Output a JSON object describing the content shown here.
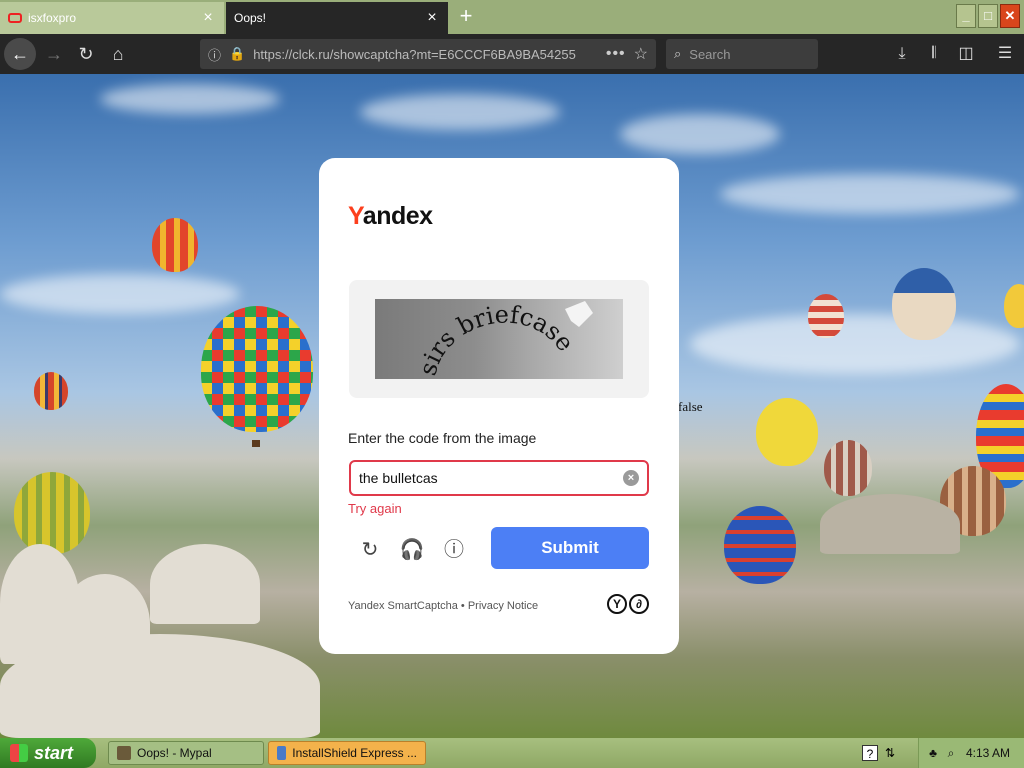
{
  "browser": {
    "tabs": [
      {
        "title": "isxfoxpro",
        "active": false
      },
      {
        "title": "Oops!",
        "active": true
      }
    ],
    "new_tab_symbol": "+",
    "url": "https://clck.ru/showcaptcha?mt=E6CCCF6BA9BA54255",
    "search_placeholder": "Search",
    "window_controls": {
      "minimize": "_",
      "maximize": "□",
      "close": "✕"
    }
  },
  "page": {
    "stray_text": "false",
    "captcha": {
      "logo": {
        "first_letter": "Y",
        "rest": "andex"
      },
      "prompt": "Enter the code from the image",
      "answer_value": "the bulletcas",
      "error": "Try again",
      "submit_label": "Submit",
      "footer": "Yandex SmartCaptcha • Privacy Notice",
      "image_words": "sirs briefcase"
    }
  },
  "taskbar": {
    "start_label": "start",
    "tasks": [
      {
        "label": "Oops! - Mypal"
      },
      {
        "label": "InstallShield Express ..."
      }
    ],
    "clock": "4:13 AM"
  },
  "colors": {
    "yandex_red": "#fc3f1d",
    "submit_blue": "#4c7ff5",
    "error_red": "#e0394a"
  }
}
